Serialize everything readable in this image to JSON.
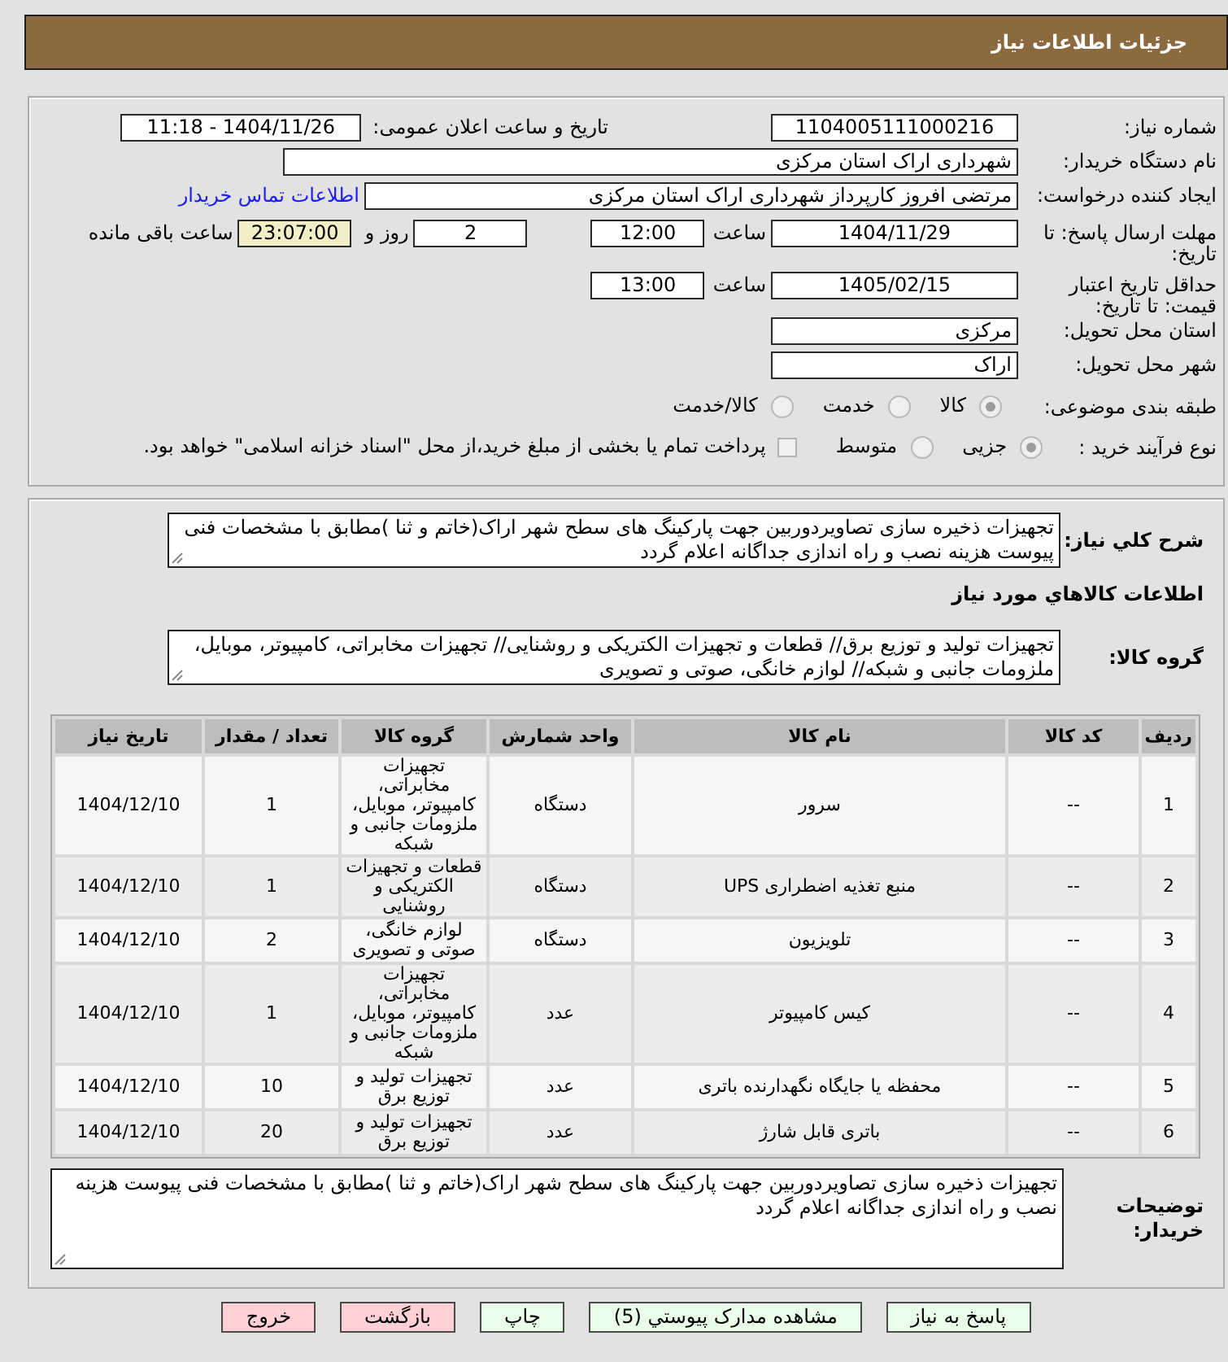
{
  "header": {
    "title": "جزئیات اطلاعات نیاز"
  },
  "details": {
    "need_number": {
      "label": "شماره نیاز:",
      "value": "1104005111000216"
    },
    "announce_datetime": {
      "label": "تاریخ و ساعت اعلان عمومی:",
      "value": "1404/11/26 - 11:18"
    },
    "buyer_org": {
      "label": "نام دستگاه خریدار:",
      "value": "شهرداری اراک استان مرکزی"
    },
    "requester": {
      "label": "ایجاد کننده درخواست:",
      "value": "مرتضی افروز کارپرداز شهرداری اراک استان مرکزی",
      "contact_link": "اطلاعات تماس خریدار"
    },
    "reply_deadline": {
      "label": "مهلت ارسال پاسخ: تا تاریخ:",
      "date": "1404/11/29",
      "time_label": "ساعت",
      "time": "12:00",
      "days": "2",
      "days_label": "روز و",
      "remaining": "23:07:00",
      "remaining_label": "ساعت باقی مانده"
    },
    "price_validity": {
      "label": "حداقل تاریخ اعتبار قیمت: تا تاریخ:",
      "date": "1405/02/15",
      "time_label": "ساعت",
      "time": "13:00"
    },
    "delivery_province": {
      "label": "استان محل تحویل:",
      "value": "مرکزی"
    },
    "delivery_city": {
      "label": "شهر محل تحویل:",
      "value": "اراک"
    },
    "subject_category": {
      "label": "طبقه بندی موضوعی:",
      "options": [
        {
          "label": "کالا",
          "selected": true
        },
        {
          "label": "خدمت",
          "selected": false
        },
        {
          "label": "کالا/خدمت",
          "selected": false
        }
      ]
    },
    "purchase_process": {
      "label": "نوع فرآیند خرید :",
      "options": [
        {
          "label": "جزیی",
          "selected": true
        },
        {
          "label": "متوسط",
          "selected": false
        }
      ],
      "treasury_payment": {
        "label": "پرداخت تمام یا بخشی از مبلغ خرید،از محل \"اسناد خزانه اسلامی\" خواهد بود.",
        "checked": false
      }
    }
  },
  "need": {
    "description_label": "شرح کلي نیاز:",
    "description": "تجهیزات ذخیره سازی تصاویردوربین جهت پارکینگ های سطح شهر اراک(خاتم و ثنا )مطابق با مشخصات فنی پیوست هزینه نصب و راه اندازی جداگانه اعلام گردد",
    "goods_heading": "اطلاعات کالاهاي مورد نیاز",
    "goods_group_label": "گروه کالا:",
    "goods_group": "تجهیزات تولید و توزیع برق// قطعات و تجهیزات الکتریکی و روشنایی// تجهیزات مخابراتی، کامپیوتر، موبایل، ملزومات جانبی و شبکه// لوازم خانگی، صوتی و تصویری"
  },
  "table": {
    "columns": [
      "ردیف",
      "کد کالا",
      "نام کالا",
      "واحد شمارش",
      "گروه کالا",
      "تعداد / مقدار",
      "تاریخ نیاز"
    ],
    "rows": [
      [
        "1",
        "--",
        "سرور",
        "دستگاه",
        "تجهیزات مخابراتی، کامپیوتر، موبایل، ملزومات جانبی و شبکه",
        "1",
        "1404/12/10"
      ],
      [
        "2",
        "--",
        "منبع تغذیه اضطراری UPS",
        "دستگاه",
        "قطعات و تجهیزات الکتریکی و روشنایی",
        "1",
        "1404/12/10"
      ],
      [
        "3",
        "--",
        "تلویزیون",
        "دستگاه",
        "لوازم خانگی، صوتی و تصویری",
        "2",
        "1404/12/10"
      ],
      [
        "4",
        "--",
        "کیس کامپیوتر",
        "عدد",
        "تجهیزات مخابراتی، کامپیوتر، موبایل، ملزومات جانبی و شبکه",
        "1",
        "1404/12/10"
      ],
      [
        "5",
        "--",
        "محفظه یا جایگاه نگهدارنده باتری",
        "عدد",
        "تجهیزات تولید و توزیع برق",
        "10",
        "1404/12/10"
      ],
      [
        "6",
        "--",
        "باتری قابل شارژ",
        "عدد",
        "تجهیزات تولید و توزیع برق",
        "20",
        "1404/12/10"
      ]
    ]
  },
  "buyer_notes": {
    "label": "توضیحات خریدار:",
    "text": "تجهیزات ذخیره سازی تصاویردوربین جهت پارکینگ های سطح شهر اراک(خاتم و ثنا )مطابق با مشخصات فنی پیوست هزینه نصب و راه اندازی جداگانه اعلام گردد"
  },
  "buttons": [
    {
      "label": "پاسخ به نیاز",
      "kind": "action"
    },
    {
      "label": "مشاهده مدارک پیوستي (5)",
      "kind": "action"
    },
    {
      "label": "چاپ",
      "kind": "action"
    },
    {
      "label": "بازگشت",
      "kind": "cancel"
    },
    {
      "label": "خروج",
      "kind": "cancel"
    }
  ]
}
